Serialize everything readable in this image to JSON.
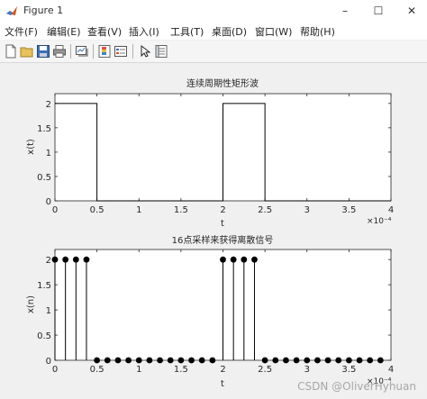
{
  "window": {
    "title": "Figure 1",
    "minimize": "–",
    "maximize": "☐",
    "close": "✕"
  },
  "menu": [
    "文件(F)",
    "编辑(E)",
    "查看(V)",
    "插入(I)",
    "工具(T)",
    "桌面(D)",
    "窗口(W)",
    "帮助(H)"
  ],
  "toolbar": [
    "new-figure-icon",
    "open-file-icon",
    "save-icon",
    "print-icon",
    "link-plot-icon",
    "insert-colorbar-icon",
    "insert-legend-icon",
    "edit-plot-icon",
    "property-inspector-icon"
  ],
  "watermark": "CSDN @OliverHyhuan",
  "chart_data": [
    {
      "type": "line",
      "title": "连续周期性矩形波",
      "xlabel": "t",
      "ylabel": "x(t)",
      "x_exponent": "×10⁻⁴",
      "xlim": [
        0,
        4
      ],
      "ylim": [
        0,
        2.2
      ],
      "xticks": [
        "0",
        "0.5",
        "1",
        "1.5",
        "2",
        "2.5",
        "3",
        "3.5",
        "4"
      ],
      "yticks": [
        "0",
        "0.5",
        "1",
        "1.5",
        "2"
      ],
      "x": [
        0,
        0.5,
        0.5,
        2,
        2,
        2.5,
        2.5,
        4
      ],
      "y": [
        2,
        2,
        0,
        0,
        2,
        2,
        0,
        0
      ],
      "grid": false
    },
    {
      "type": "scatter",
      "style": "stem",
      "title": "16点采样来获得离散信号",
      "xlabel": "t",
      "ylabel": "x(n)",
      "x_exponent": "×10⁻⁴",
      "xlim": [
        0,
        4
      ],
      "ylim": [
        0,
        2.2
      ],
      "xticks": [
        "0",
        "0.5",
        "1",
        "1.5",
        "2",
        "2.5",
        "3",
        "3.5",
        "4"
      ],
      "yticks": [
        "0",
        "0.5",
        "1",
        "1.5",
        "2"
      ],
      "x": [
        0,
        0.125,
        0.25,
        0.375,
        0.5,
        0.625,
        0.75,
        0.875,
        1,
        1.125,
        1.25,
        1.375,
        1.5,
        1.625,
        1.75,
        1.875,
        2,
        2.125,
        2.25,
        2.375,
        2.5,
        2.625,
        2.75,
        2.875,
        3,
        3.125,
        3.25,
        3.375,
        3.5,
        3.625,
        3.75,
        3.875
      ],
      "y": [
        2,
        2,
        2,
        2,
        0,
        0,
        0,
        0,
        0,
        0,
        0,
        0,
        0,
        0,
        0,
        0,
        2,
        2,
        2,
        2,
        0,
        0,
        0,
        0,
        0,
        0,
        0,
        0,
        0,
        0,
        0,
        0
      ],
      "grid": false
    }
  ]
}
